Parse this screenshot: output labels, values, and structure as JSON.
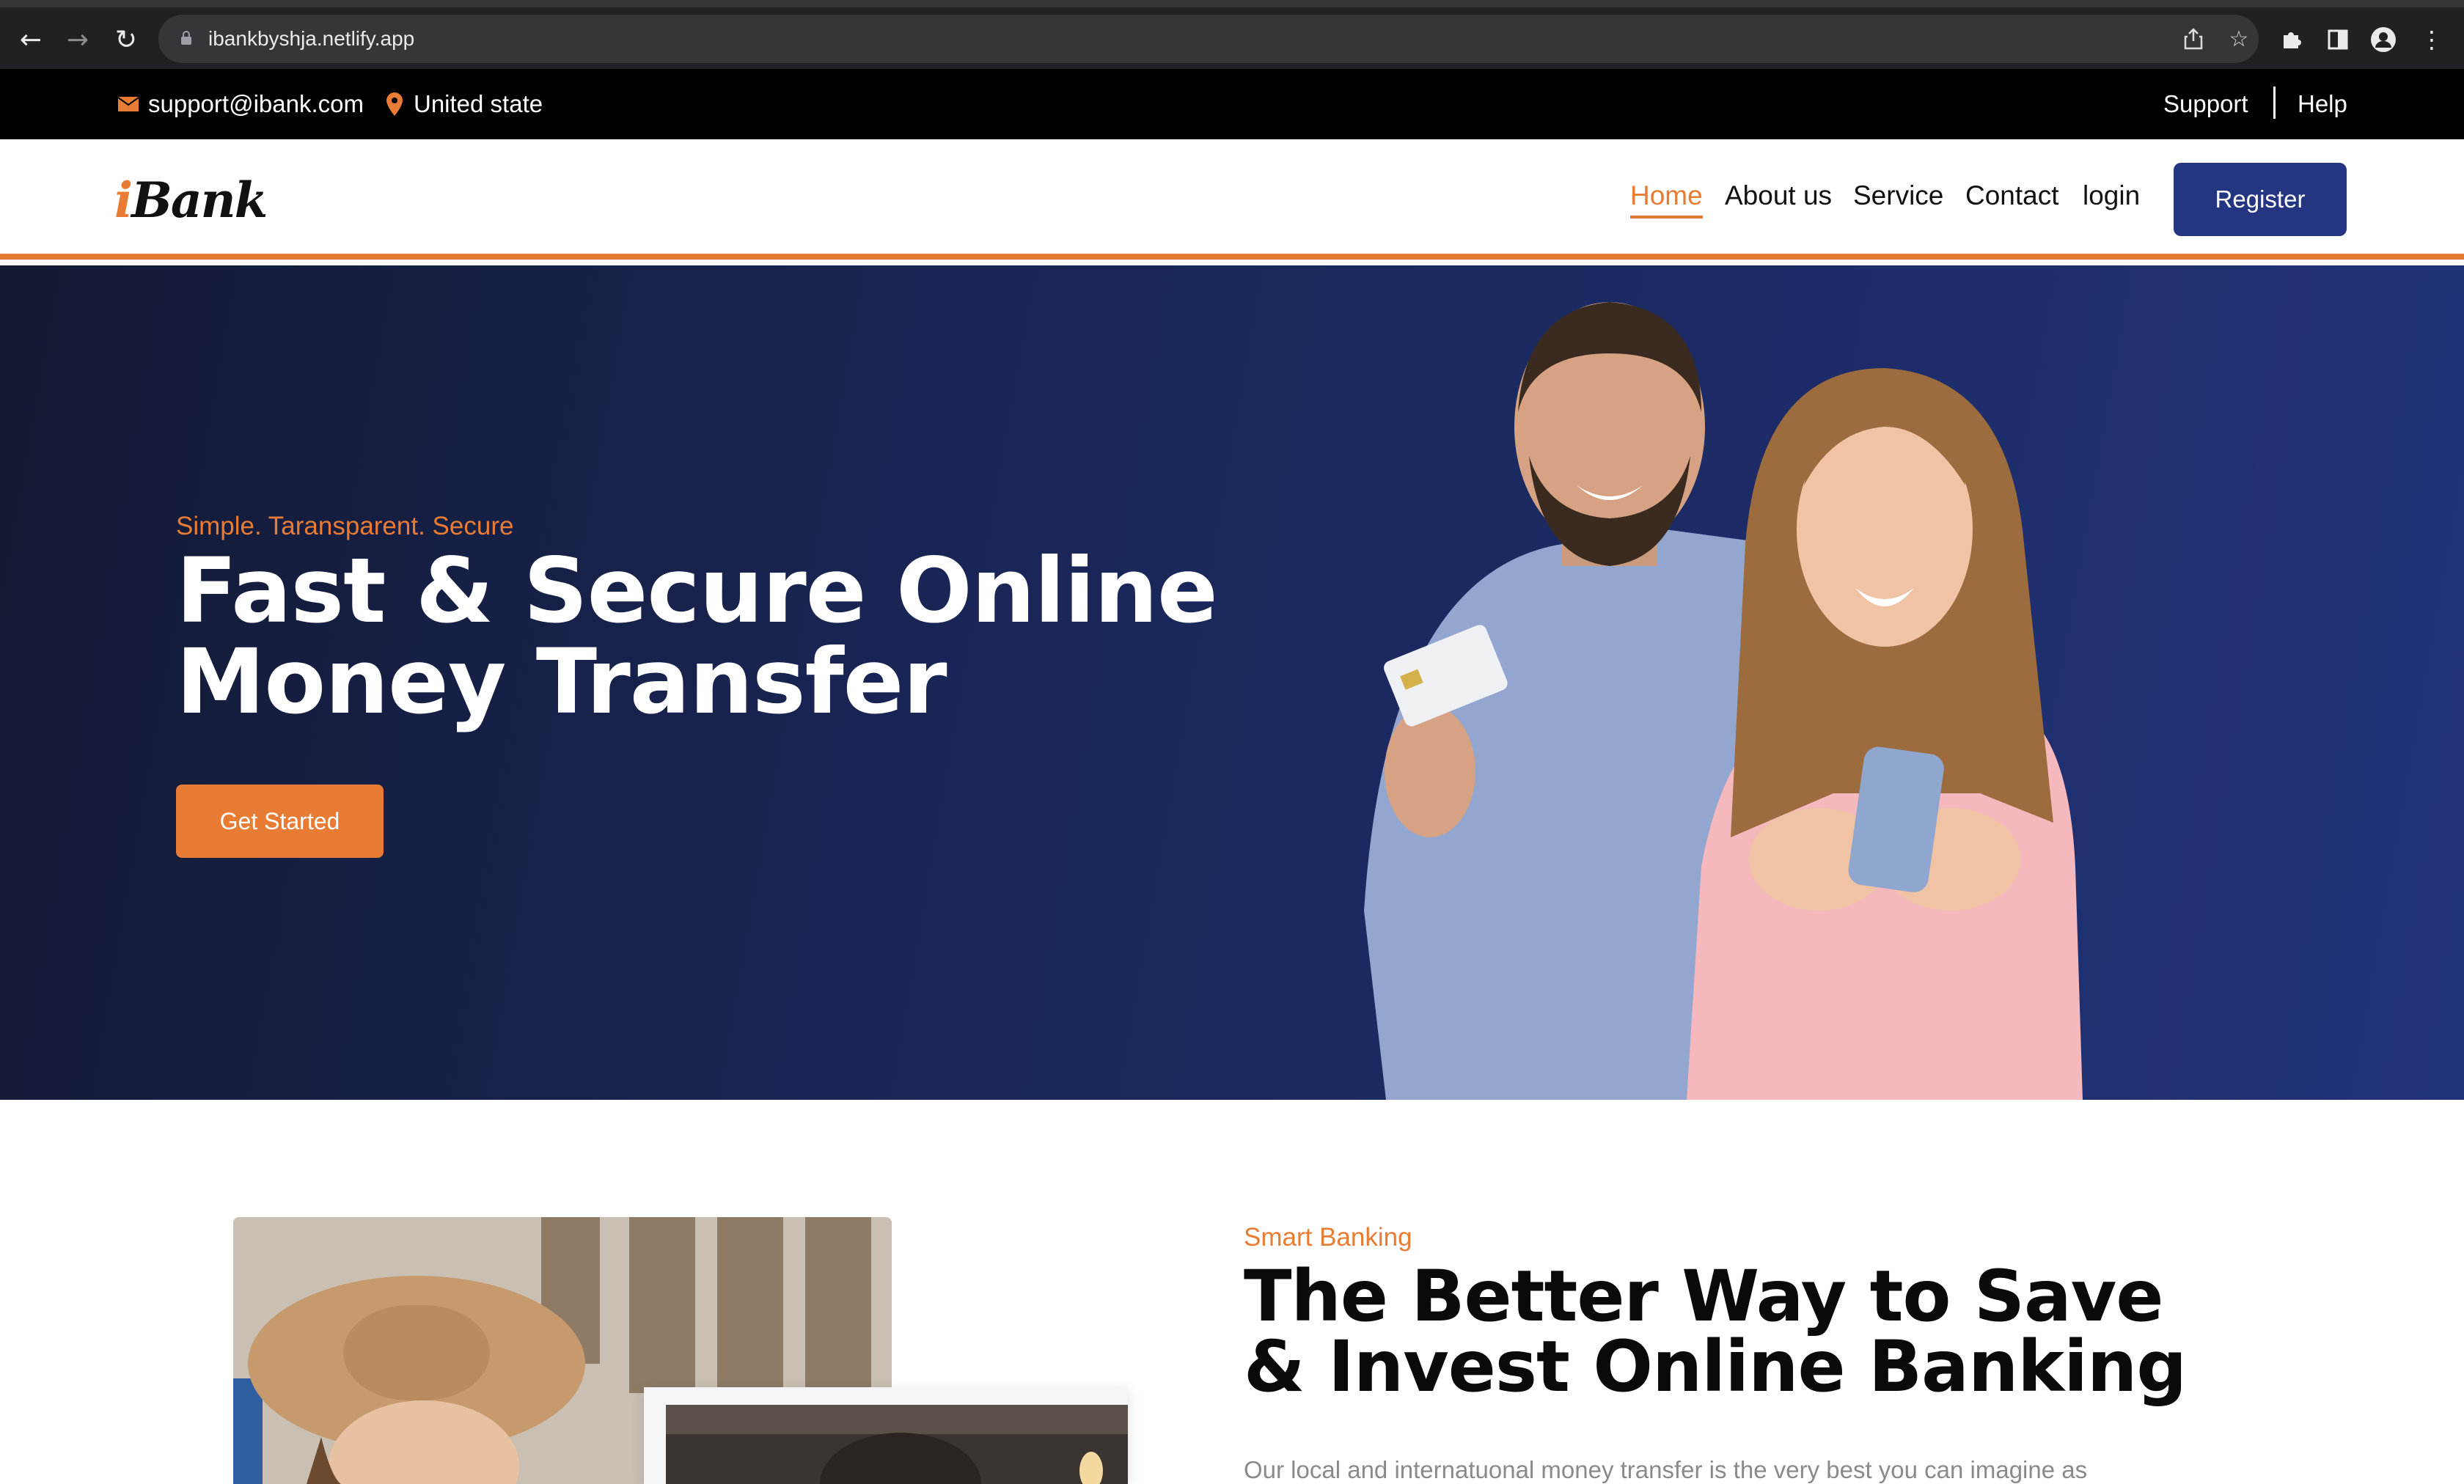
{
  "browser": {
    "url": "ibankbyshja.netlify.app",
    "icons": {
      "back": "arrow-left-icon",
      "forward": "arrow-right-icon",
      "reload": "reload-icon",
      "lock": "lock-icon",
      "share": "share-icon",
      "bookmark": "star-icon",
      "extensions": "puzzle-icon",
      "sidepanel": "sidepanel-icon",
      "profile": "profile-icon",
      "menu": "kebab-menu-icon"
    }
  },
  "topbar": {
    "email": "support@ibank.com",
    "location": "United state",
    "support": "Support",
    "help": "Help"
  },
  "navbar": {
    "logo_prefix": "i",
    "logo_text": "Bank",
    "links": [
      "Home",
      "About us",
      "Service",
      "Contact",
      "login"
    ],
    "active_link": "Home",
    "register": "Register"
  },
  "hero": {
    "eyebrow": "Simple. Taransparent. Secure",
    "title": "Fast & Secure Online Money Transfer",
    "cta": "Get Started"
  },
  "about": {
    "eyebrow": "Smart Banking",
    "title": "The Better Way to Save & Invest Online Banking",
    "text": "Our local and internatuonal money transfer is the very best you can imagine as"
  },
  "colors": {
    "accent": "#e87c35",
    "brand_navy": "#243582",
    "hero_dark": "#131a33",
    "hero_light": "#21337a",
    "topbar_bg": "#000000"
  }
}
